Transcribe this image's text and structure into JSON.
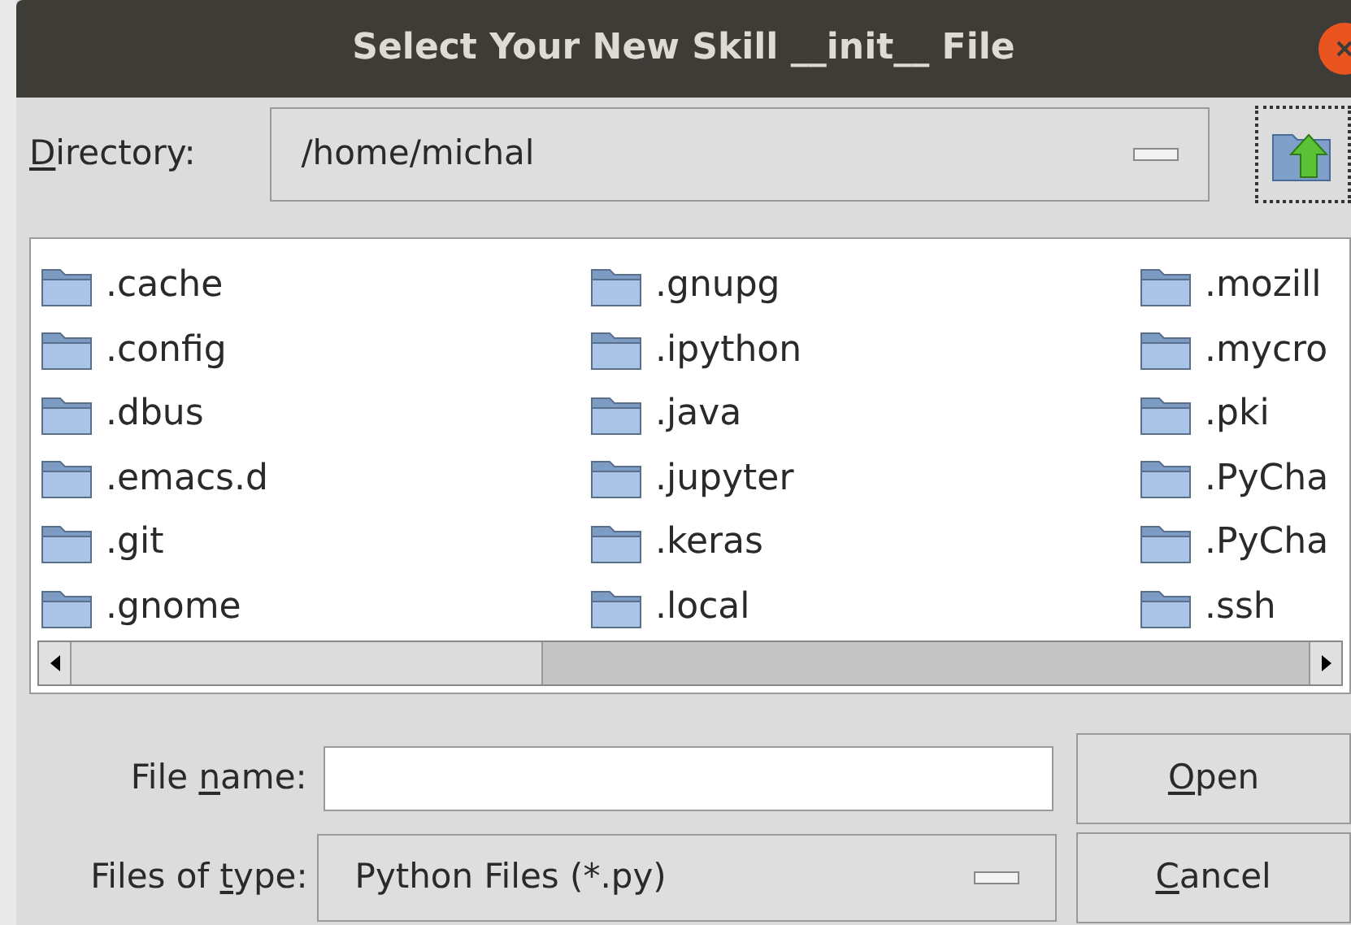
{
  "window": {
    "title": "Select Your New Skill __init__ File"
  },
  "directory": {
    "label": {
      "key": "D",
      "after": "irectory:"
    },
    "value": "/home/michal"
  },
  "files": [
    {
      "name": ".cache"
    },
    {
      "name": ".config"
    },
    {
      "name": ".dbus"
    },
    {
      "name": ".emacs.d"
    },
    {
      "name": ".git"
    },
    {
      "name": ".gnome"
    },
    {
      "name": ".gnupg"
    },
    {
      "name": ".ipython"
    },
    {
      "name": ".java"
    },
    {
      "name": ".jupyter"
    },
    {
      "name": ".keras"
    },
    {
      "name": ".local"
    },
    {
      "name": ".mozill"
    },
    {
      "name": ".mycro"
    },
    {
      "name": ".pki"
    },
    {
      "name": ".PyCha"
    },
    {
      "name": ".PyCha"
    },
    {
      "name": ".ssh"
    }
  ],
  "file_name": {
    "label": {
      "before": "File ",
      "key": "n",
      "after": "ame:"
    }
  },
  "file_type": {
    "label": {
      "before": "Files of ",
      "key": "t",
      "after": "ype:"
    },
    "value": "Python Files (*.py)"
  },
  "buttons": [
    {
      "key": "O",
      "after": "pen"
    },
    {
      "key": "C",
      "after": "ancel"
    }
  ]
}
